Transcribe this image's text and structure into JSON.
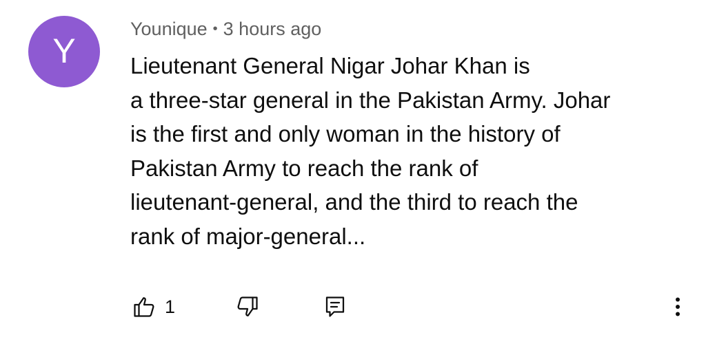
{
  "comment": {
    "avatar": {
      "letter": "Y",
      "color": "#8e5ad2"
    },
    "author": "Younique",
    "separator": "•",
    "timestamp": "3 hours ago",
    "text_lines": [
      "Lieutenant General Nigar Johar Khan is",
      "a three-star general in the Pakistan Army. Johar",
      "is the first and only woman in the history of",
      "Pakistan Army to reach the rank of",
      "lieutenant-general, and the third to reach the",
      "rank of major-general..."
    ],
    "actions": {
      "like_icon": "thumbs-up-icon",
      "like_count": "1",
      "dislike_icon": "thumbs-down-icon",
      "reply_icon": "reply-comment-icon",
      "more_icon": "more-vertical-icon"
    }
  }
}
